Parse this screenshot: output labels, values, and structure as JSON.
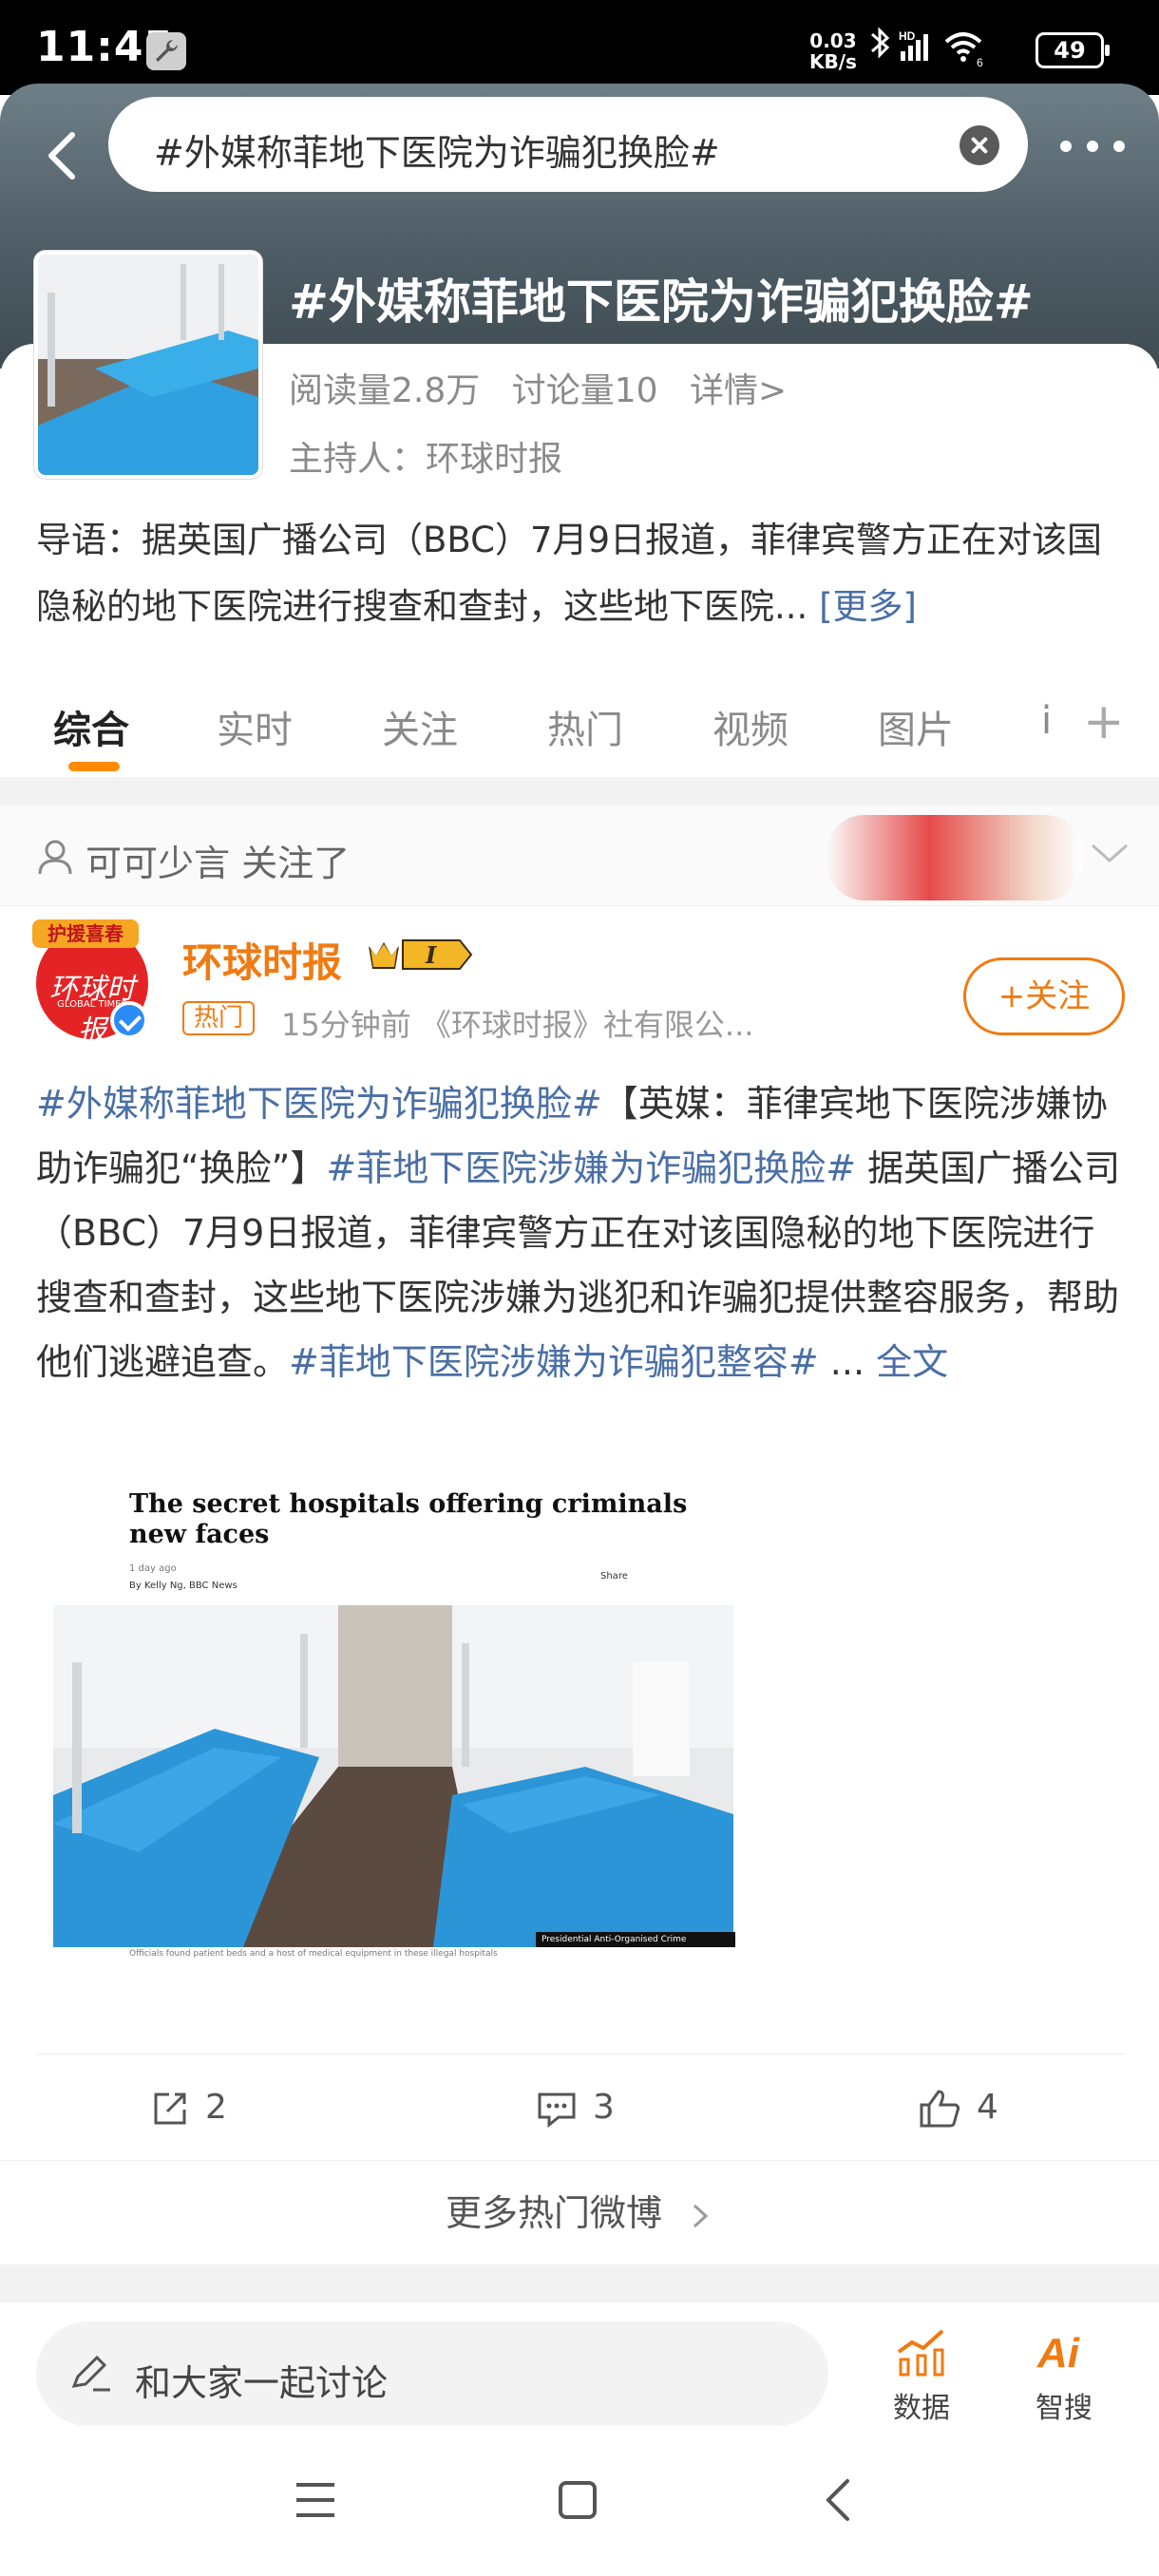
{
  "status_bar": {
    "time": "11:45",
    "net_speed_value": "0.03",
    "net_speed_unit": "KB/s",
    "battery": "49"
  },
  "search": {
    "query": "#外媒称菲地下医院为诈骗犯换脸#"
  },
  "topic": {
    "title": "#外媒称菲地下医院为诈骗犯换脸#",
    "reads": "阅读量2.8万",
    "discussions": "讨论量10",
    "details": "详情>",
    "host": "主持人：环球时报",
    "intro": "导语：据英国广播公司（BBC）7月9日报道，菲律宾警方正在对该国隐秘的地下医院进行搜查和查封，这些地下医院...",
    "intro_more": "[更多]"
  },
  "tabs": [
    {
      "label": "综合"
    },
    {
      "label": "实时"
    },
    {
      "label": "关注"
    },
    {
      "label": "热门"
    },
    {
      "label": "视频"
    },
    {
      "label": "图片"
    },
    {
      "label": "i"
    }
  ],
  "follow_bar": {
    "text": "可可少言 关注了"
  },
  "post": {
    "author": "环球时报",
    "avatar_ribbon": "护援喜春",
    "avatar_text": "环球时报",
    "avatar_sub": "GLOBAL TIMES",
    "vip_level": "I",
    "hot_tag": "热门",
    "time_source": "15分钟前  《环球时报》社有限公...",
    "follow_label": "+关注",
    "body_hash1": "#外媒称菲地下医院为诈骗犯换脸#",
    "body_text1": "【英媒：菲律宾地下医院涉嫌协助诈骗犯“换脸”】",
    "body_hash2": "#菲地下医院涉嫌为诈骗犯换脸#",
    "body_text2": " 据英国广播公司（BBC）7月9日报道，菲律宾警方正在对该国隐秘的地下医院进行搜查和查封，这些地下医院涉嫌为逃犯和诈骗犯提供整容服务，帮助他们逃避追查。",
    "body_hash3": "#菲地下医院涉嫌为诈骗犯整容#",
    "body_ellipsis": " ... ",
    "full_text": "全文",
    "image": {
      "headline": "The secret hospitals offering criminals new faces",
      "date": "1 day ago",
      "byline": "By Kelly Ng, BBC News",
      "share": "Share",
      "credit": "Presidential Anti-Organised Crime Commission",
      "caption": "Officials found patient beds and a host of medical equipment in these illegal hospitals"
    },
    "reposts": "2",
    "comments": "3",
    "likes": "4",
    "more_hot": "更多热门微博"
  },
  "bottom_bar": {
    "discuss_placeholder": "和大家一起讨论",
    "data_label": "数据",
    "ai_label": "智搜"
  },
  "colors": {
    "accent_orange": "#f07a12",
    "link_blue": "#4a6fa5",
    "tab_indicator": "#ff8a00"
  }
}
